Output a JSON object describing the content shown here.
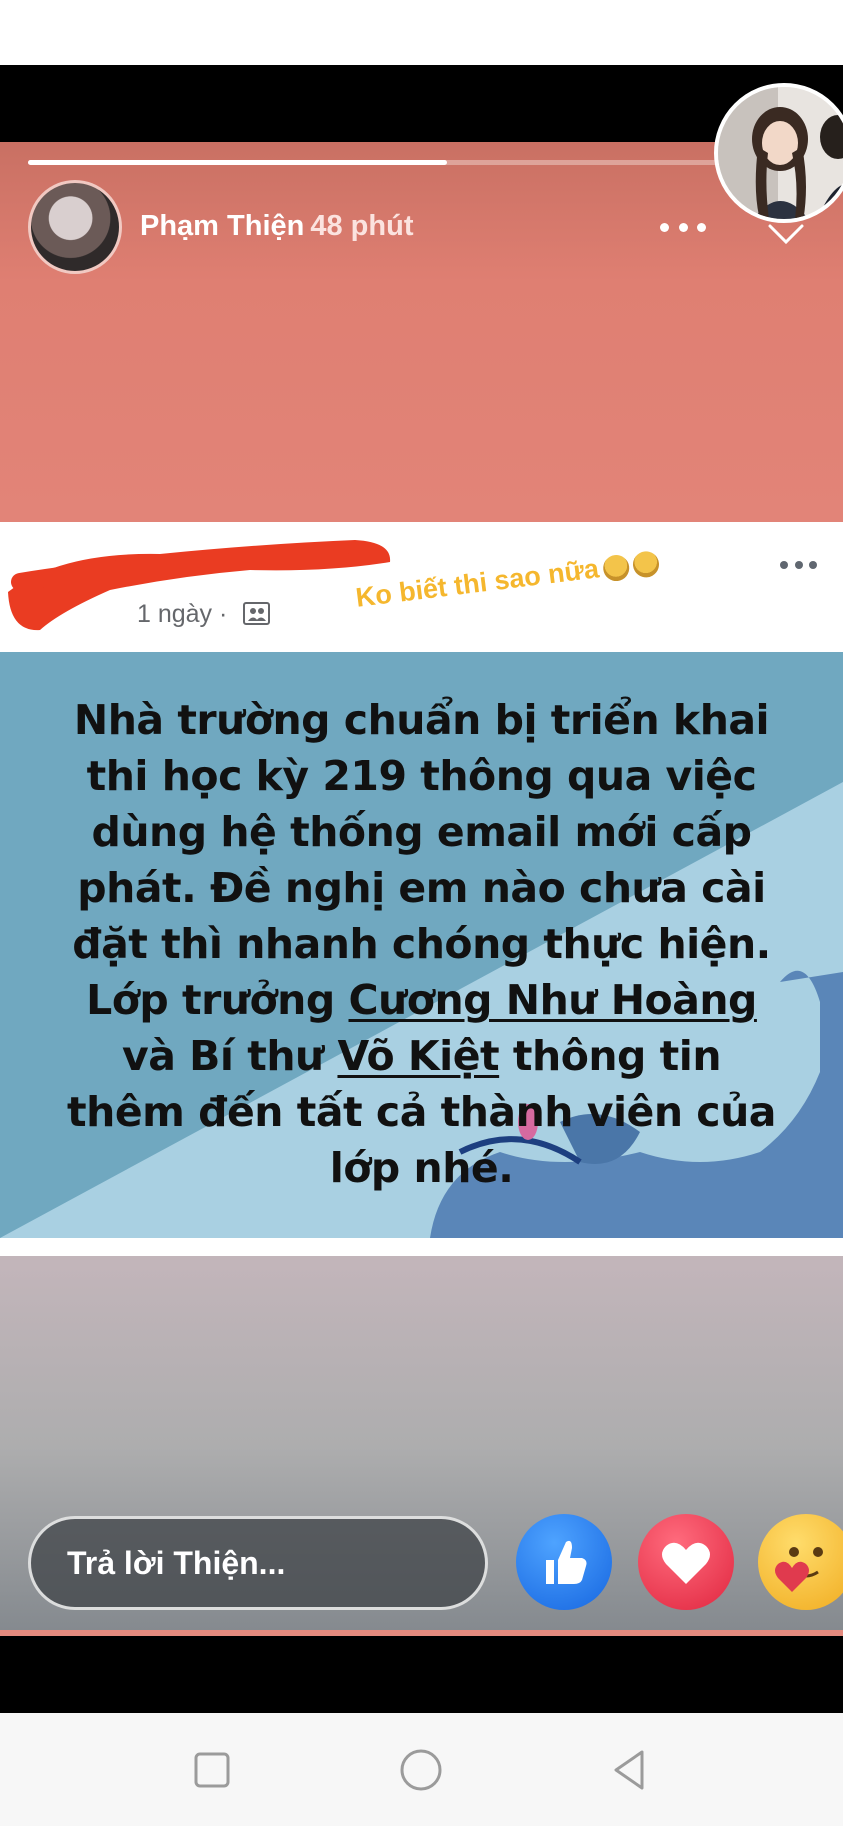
{
  "story": {
    "author_name": "Phạm Thiện",
    "time_ago": "48 phút",
    "progress": 0.53
  },
  "post": {
    "meta_time": "1 ngày ·",
    "caption": "Ko biết thi sao nữa",
    "notice_lines": [
      "Nhà trường chuẩn bị triển khai",
      "thi học kỳ 219 thông qua việc",
      "dùng hệ thống email mới cấp",
      "phát. Đề nghị em nào chưa cài",
      "đặt thì nhanh chóng thực hiện."
    ],
    "line6_prefix": "Lớp trưởng ",
    "line6_name": "Cương Như Hoàng",
    "line7_prefix": "và Bí thư ",
    "line7_name": "Võ Kiệt",
    "line7_suffix": " thông tin",
    "line8": "thêm đến tất cả thành viên của",
    "line9": "lớp nhé."
  },
  "reply": {
    "placeholder": "Trả lời Thiện..."
  },
  "colors": {
    "story_bg": "#e28478",
    "like": "#1877f2",
    "love": "#f33e58",
    "caption": "#f5b72e"
  },
  "icons": [
    "more-icon",
    "close-icon",
    "audience-icon",
    "like-icon",
    "love-icon",
    "care-icon",
    "recent-apps-icon",
    "home-icon",
    "back-icon"
  ]
}
